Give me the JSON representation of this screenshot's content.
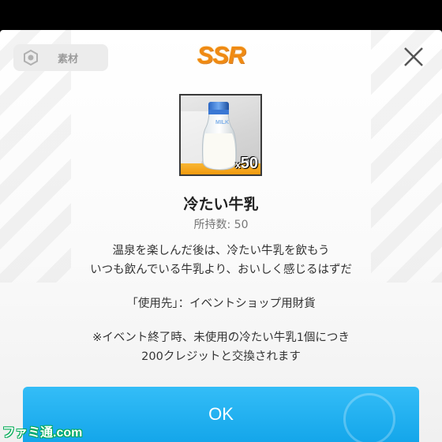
{
  "header": {
    "category_label": "素材",
    "category_icon": "hexagon-gear-icon",
    "rarity": "SSR",
    "rarity_color": "#f08a12"
  },
  "item": {
    "name": "冷たい牛乳",
    "quantity_prefix": "x",
    "quantity": "50",
    "owned": "所持数: 50",
    "image": "milk-bottle-icon",
    "bottle_label": "MILK"
  },
  "description": {
    "lines": [
      "温泉を楽しんだ後は、冷たい牛乳を飲もう",
      "いつも飲んでいる牛乳より、おいしく感じるはずだ"
    ],
    "usage": "「使用先」：イベントショップ用財貨",
    "note_lines": [
      "※イベント終了時、未使用の冷たい牛乳1個につき",
      "200クレジットと交換されます"
    ]
  },
  "actions": {
    "ok_label": "OK",
    "ok_color": "#1ea8ec"
  },
  "watermark": "ファミ通.com"
}
